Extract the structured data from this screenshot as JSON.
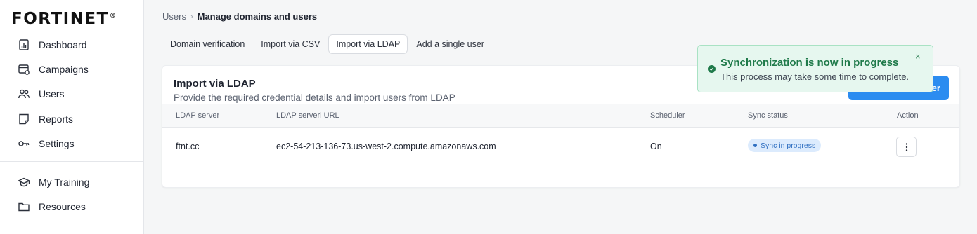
{
  "brand": {
    "logo_text": "FORTINET",
    "logo_mark": "®"
  },
  "sidebar": {
    "items": [
      {
        "label": "Dashboard",
        "icon": "dashboard-icon"
      },
      {
        "label": "Campaigns",
        "icon": "campaigns-icon"
      },
      {
        "label": "Users",
        "icon": "users-icon"
      },
      {
        "label": "Reports",
        "icon": "reports-icon"
      },
      {
        "label": "Settings",
        "icon": "settings-key-icon"
      },
      {
        "label": "My Training",
        "icon": "graduation-cap-icon"
      },
      {
        "label": "Resources",
        "icon": "folder-icon"
      }
    ]
  },
  "breadcrumb": {
    "root": "Users",
    "separator": "›",
    "current": "Manage domains and users"
  },
  "tabs": [
    {
      "label": "Domain verification",
      "active": false
    },
    {
      "label": "Import via CSV",
      "active": false
    },
    {
      "label": "Import via LDAP",
      "active": true
    },
    {
      "label": "Add a single user",
      "active": false
    }
  ],
  "card": {
    "title": "Import via LDAP",
    "subtitle": "Provide the required credential details and import users from LDAP",
    "primary_button_visible_label": "er"
  },
  "table": {
    "columns": [
      "LDAP server",
      "LDAP serverl URL",
      "Scheduler",
      "Sync status",
      "Action"
    ],
    "rows": [
      {
        "server": "ftnt.cc",
        "url": "ec2-54-213-136-73.us-west-2.compute.amazonaws.com",
        "scheduler": "On",
        "sync_status": "Sync in progress"
      }
    ]
  },
  "toast": {
    "title": "Synchronization is now in progress",
    "message": "This process may take some time to complete.",
    "close": "×"
  },
  "colors": {
    "accent": "#2b8cf0",
    "success": "#1f7a4a",
    "toast_bg": "#e6f7ef",
    "badge_bg": "#dcebfd"
  }
}
